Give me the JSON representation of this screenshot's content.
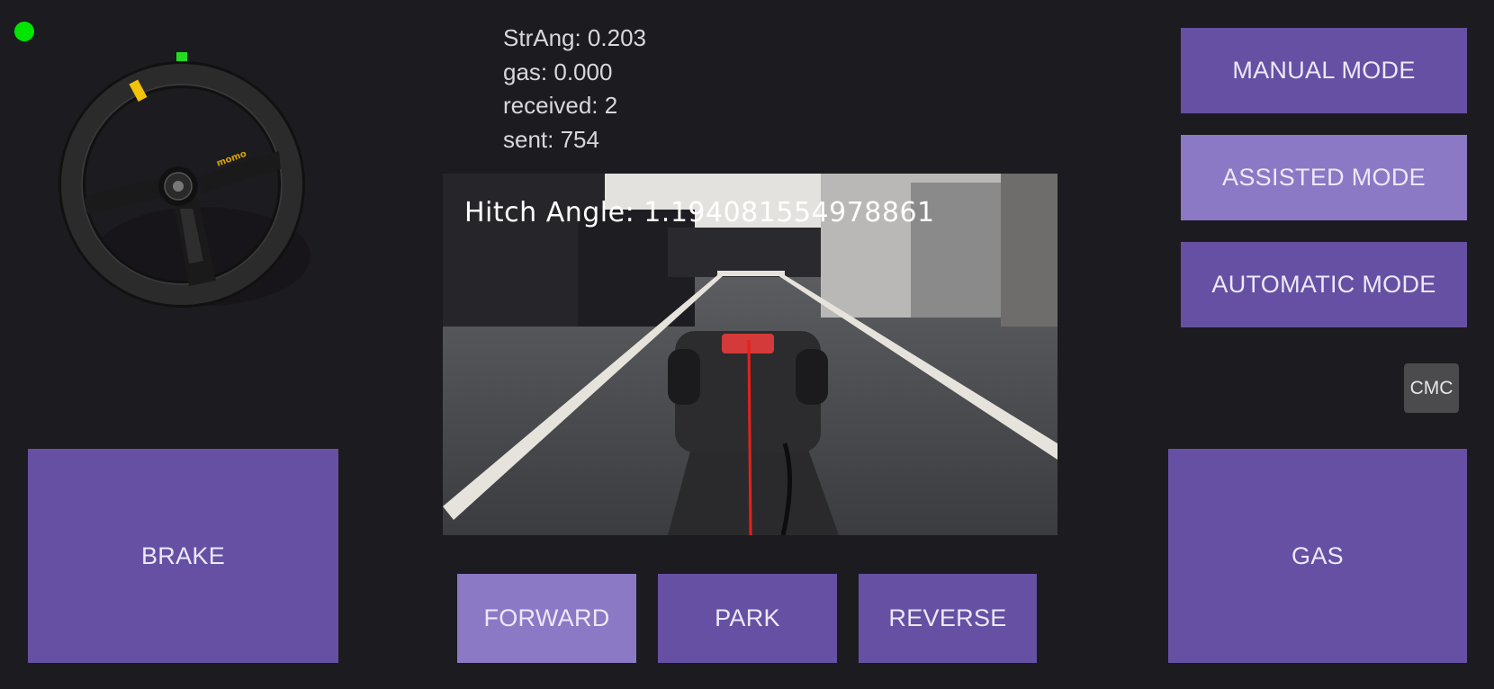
{
  "status": {
    "connected_color": "#00e600"
  },
  "steering": {
    "icon": "steering-wheel-icon",
    "brand": "momo"
  },
  "telemetry": {
    "str_ang": "StrAng: 0.203",
    "gas": "gas: 0.000",
    "received": "received: 2",
    "sent": "sent: 754"
  },
  "camera": {
    "hitch_label": "Hitch Angle: 1.194081554978861"
  },
  "modes": {
    "manual": "MANUAL MODE",
    "assisted": "ASSISTED MODE",
    "automatic": "AUTOMATIC MODE",
    "active": "assisted"
  },
  "cmc_label": "CMC",
  "controls": {
    "brake": "BRAKE",
    "gas": "GAS"
  },
  "gears": {
    "forward": "FORWARD",
    "park": "PARK",
    "reverse": "REVERSE",
    "active": "forward"
  },
  "colors": {
    "button": "#6650a4",
    "button_active": "#8b79c6",
    "background": "#1c1b20"
  }
}
